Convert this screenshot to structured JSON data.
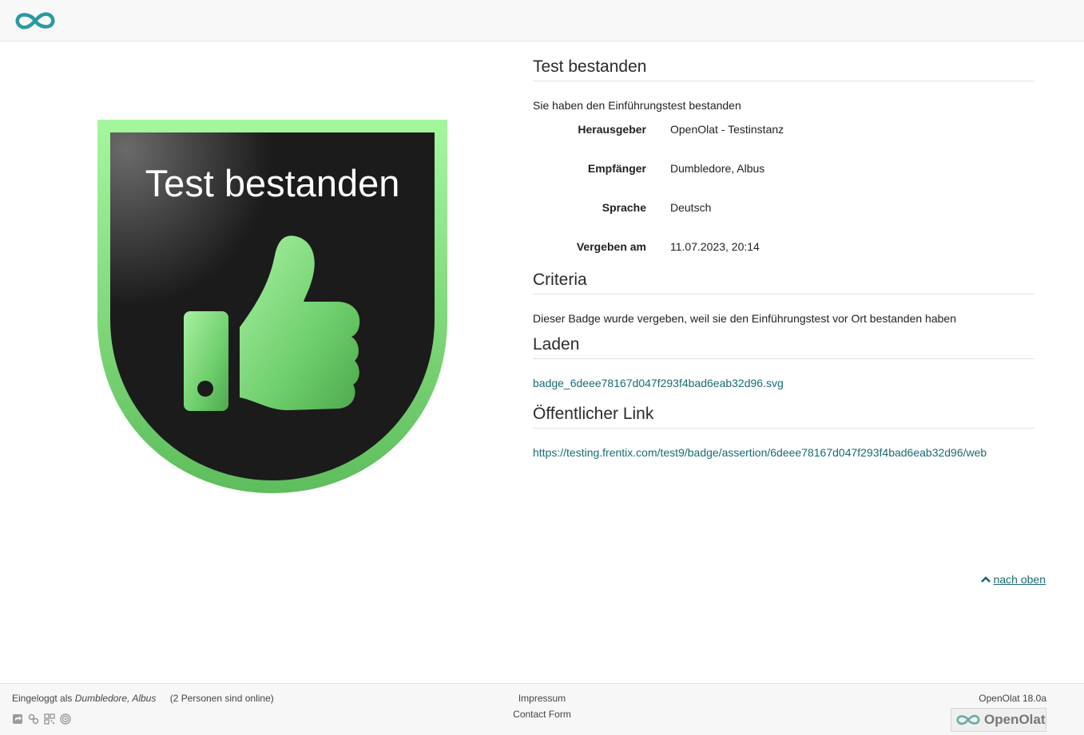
{
  "header": {
    "logo_icon": "openolat-infinity-logo"
  },
  "badge": {
    "image_title": "Test bestanden",
    "icon": "thumbs-up-icon",
    "colors": {
      "border": "#86e07e",
      "inner": "#1b1b1b",
      "thumb": "#6fd174"
    }
  },
  "main": {
    "title": "Test bestanden",
    "description": "Sie haben den Einführungstest bestanden",
    "properties": [
      {
        "label": "Herausgeber",
        "value": "OpenOlat - Testinstanz"
      },
      {
        "label": "Empfänger",
        "value": "Dumbledore, Albus"
      },
      {
        "label": "Sprache",
        "value": "Deutsch"
      },
      {
        "label": "Vergeben am",
        "value": "11.07.2023, 20:14"
      }
    ],
    "criteria_title": "Criteria",
    "criteria_text": "Dieser Badge wurde vergeben, weil sie den Einführungstest vor Ort bestanden haben",
    "download_title": "Laden",
    "download_link": "badge_6deee78167d047f293f4bad6eab32d96.svg",
    "public_link_title": "Öffentlicher Link",
    "public_link": "https://testing.frentix.com/test9/badge/assertion/6deee78167d047f293f4bad6eab32d96/web"
  },
  "to_top": {
    "label": "nach oben"
  },
  "footer": {
    "logged_in_prefix": "Eingeloggt als",
    "user": "Dumbledore, Albus",
    "online": "(2 Personen sind online)",
    "impressum": "Impressum",
    "contact": "Contact Form",
    "version": "OpenOlat 18.0a",
    "powered_by": "OpenOlat",
    "accent_color": "#1a6a72"
  }
}
